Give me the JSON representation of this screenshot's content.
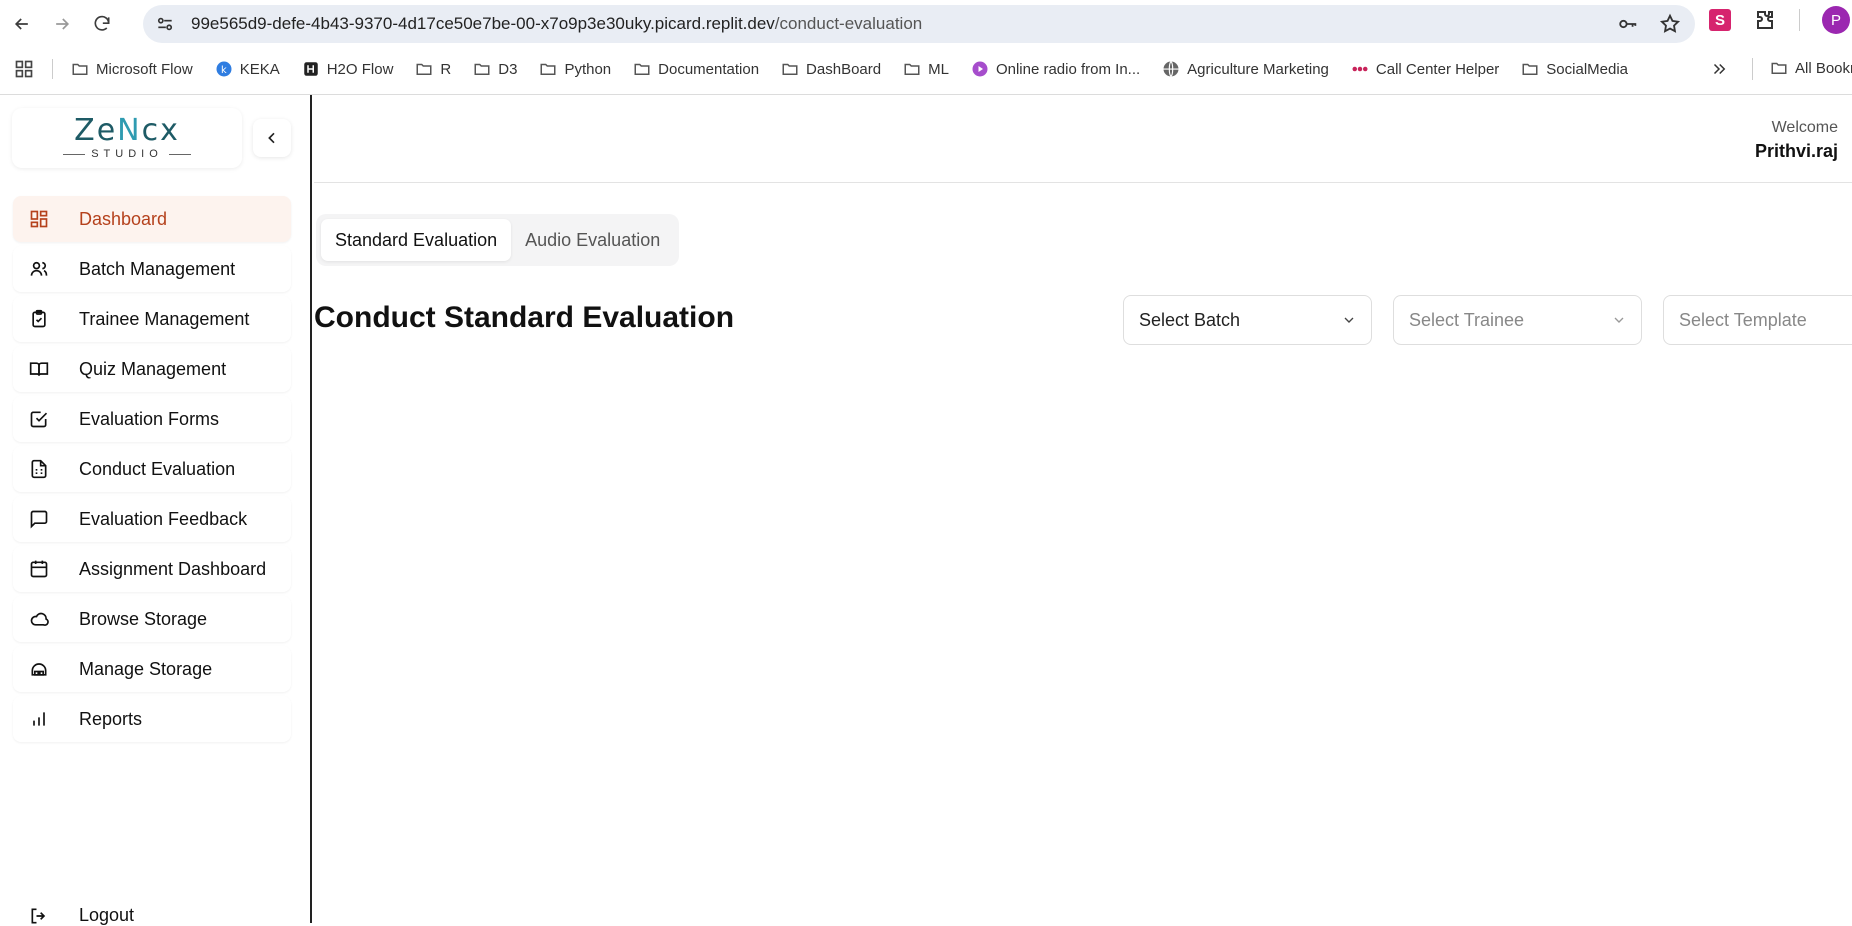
{
  "browser": {
    "url_host": "99e565d9-defe-4b43-9370-4d17ce50e7be-00-x7o9p3e30uky.picard.replit.dev",
    "url_path": "/conduct-evaluation",
    "profile_initial": "P",
    "bookmarks": [
      {
        "label": "Microsoft Flow",
        "icon": "folder-icon"
      },
      {
        "label": "KEKA",
        "icon": "keka-icon"
      },
      {
        "label": "H2O Flow",
        "icon": "h2o-icon"
      },
      {
        "label": "R",
        "icon": "folder-icon"
      },
      {
        "label": "D3",
        "icon": "folder-icon"
      },
      {
        "label": "Python",
        "icon": "folder-icon"
      },
      {
        "label": "Documentation",
        "icon": "folder-icon"
      },
      {
        "label": "DashBoard",
        "icon": "folder-icon"
      },
      {
        "label": "ML",
        "icon": "folder-icon"
      },
      {
        "label": "Online radio from In...",
        "icon": "radio-icon"
      },
      {
        "label": "Agriculture Marketing",
        "icon": "globe-icon"
      },
      {
        "label": "Call Center Helper",
        "icon": "dots-icon"
      },
      {
        "label": "SocialMedia",
        "icon": "folder-icon"
      }
    ],
    "all_bookmarks_label": "All Bookmarks"
  },
  "logo": {
    "main_a": "Ze",
    "main_b": "N",
    "main_c": "cx",
    "sub": "STUDIO"
  },
  "sidebar": {
    "items": [
      {
        "label": "Dashboard",
        "icon": "dashboard-icon"
      },
      {
        "label": "Batch Management",
        "icon": "users-icon"
      },
      {
        "label": "Trainee Management",
        "icon": "clipboard-check-icon"
      },
      {
        "label": "Quiz Management",
        "icon": "book-open-icon"
      },
      {
        "label": "Evaluation Forms",
        "icon": "check-square-icon"
      },
      {
        "label": "Conduct Evaluation",
        "icon": "file-text-icon"
      },
      {
        "label": "Evaluation Feedback",
        "icon": "message-square-icon"
      },
      {
        "label": "Assignment Dashboard",
        "icon": "calendar-icon"
      },
      {
        "label": "Browse Storage",
        "icon": "cloud-icon"
      },
      {
        "label": "Manage Storage",
        "icon": "storage-icon"
      },
      {
        "label": "Reports",
        "icon": "bar-chart-icon"
      }
    ],
    "logout_label": "Logout"
  },
  "header": {
    "welcome": "Welcome",
    "username": "Prithvi.raj"
  },
  "tabs": [
    {
      "label": "Standard Evaluation",
      "active": true
    },
    {
      "label": "Audio Evaluation",
      "active": false
    }
  ],
  "page_title": "Conduct Standard Evaluation",
  "filters": {
    "batch": "Select Batch",
    "trainee": "Select Trainee",
    "template": "Select Template"
  },
  "colors": {
    "active_bg": "#fdf3ee",
    "active_text": "#b5411c",
    "brand_dark": "#1e5b66",
    "brand_light": "#2f9bb1"
  }
}
